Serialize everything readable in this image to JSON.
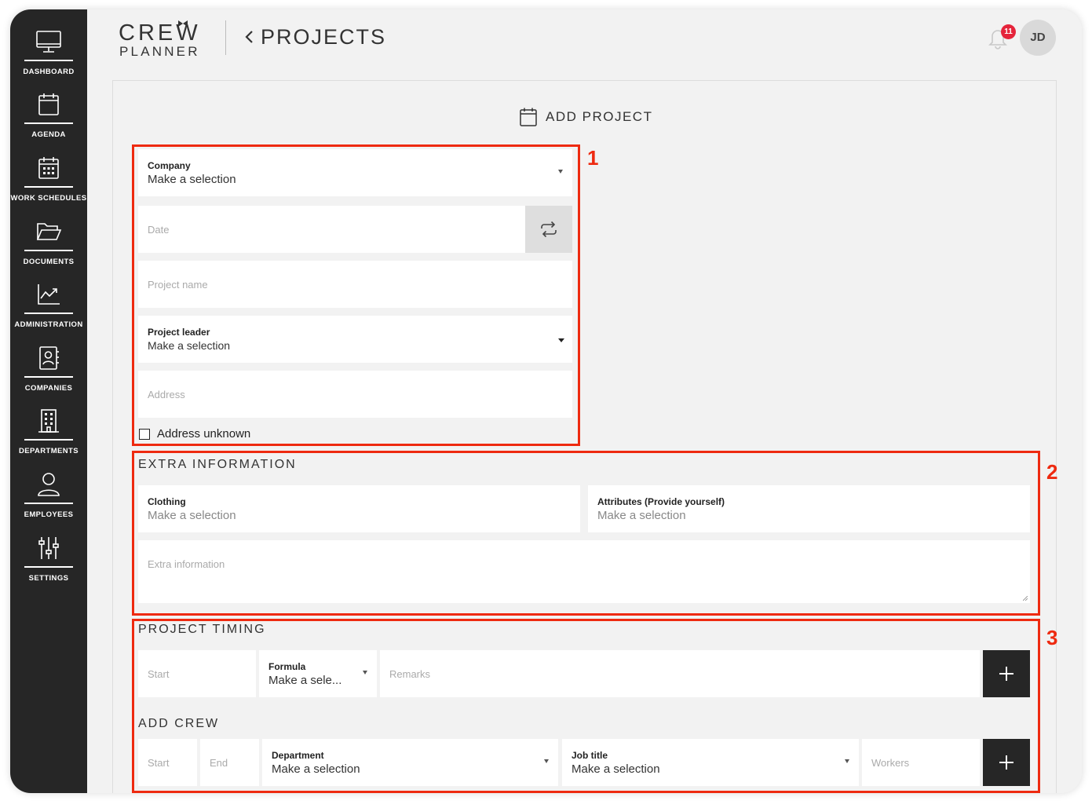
{
  "sidebar": {
    "items": [
      {
        "label": "DASHBOARD",
        "icon": "monitor-icon"
      },
      {
        "label": "AGENDA",
        "icon": "calendar-icon"
      },
      {
        "label": "WORK SCHEDULES",
        "icon": "schedule-calendar-icon"
      },
      {
        "label": "DOCUMENTS",
        "icon": "folder-icon"
      },
      {
        "label": "ADMINISTRATION",
        "icon": "chart-icon"
      },
      {
        "label": "COMPANIES",
        "icon": "contact-book-icon"
      },
      {
        "label": "DEPARTMENTS",
        "icon": "building-icon"
      },
      {
        "label": "EMPLOYEES",
        "icon": "user-icon"
      },
      {
        "label": "SETTINGS",
        "icon": "sliders-icon"
      }
    ]
  },
  "header": {
    "logo_top": "CREW",
    "logo_bottom": "PLANNER",
    "title": "PROJECTS",
    "notification_count": "11",
    "avatar_initials": "JD"
  },
  "card": {
    "title": "ADD PROJECT"
  },
  "form": {
    "company": {
      "label": "Company",
      "value": "Make a selection"
    },
    "date": {
      "placeholder": "Date"
    },
    "project_name": {
      "placeholder": "Project name"
    },
    "project_leader": {
      "label": "Project leader",
      "value": "Make a selection"
    },
    "address": {
      "placeholder": "Address"
    },
    "address_unknown": "Address unknown"
  },
  "extra": {
    "title": "EXTRA INFORMATION",
    "clothing": {
      "label": "Clothing",
      "value": "Make a selection"
    },
    "attributes": {
      "label": "Attributes (Provide yourself)",
      "value": "Make a selection"
    },
    "extra_info": {
      "placeholder": "Extra information"
    }
  },
  "timing": {
    "title": "PROJECT TIMING",
    "start": {
      "placeholder": "Start"
    },
    "formula": {
      "label": "Formula",
      "value": "Make a sele..."
    },
    "remarks": {
      "placeholder": "Remarks"
    }
  },
  "crew": {
    "title": "ADD CREW",
    "start": {
      "placeholder": "Start"
    },
    "end": {
      "placeholder": "End"
    },
    "department": {
      "label": "Department",
      "value": "Make a selection"
    },
    "job_title": {
      "label": "Job title",
      "value": "Make a selection"
    },
    "workers": {
      "placeholder": "Workers"
    }
  },
  "annotations": [
    "1",
    "2",
    "3"
  ],
  "colors": {
    "sidebar": "#262626",
    "background": "#f2f2f2",
    "annotation_red": "#ee2a10",
    "badge_red": "#e5243b"
  }
}
